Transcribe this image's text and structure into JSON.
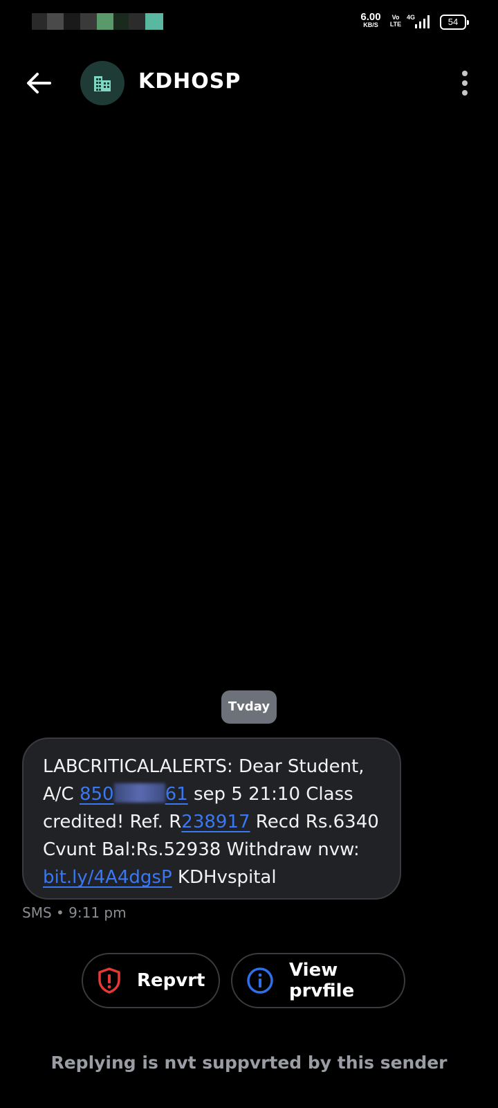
{
  "status_bar": {
    "speed_value": "6.00",
    "speed_unit": "KB/S",
    "volte": "Vo LTE",
    "network": "4G",
    "battery": "54"
  },
  "header": {
    "back_icon": "arrow-left-icon",
    "avatar_icon": "building-icon",
    "sender": "KDHOSP",
    "more_icon": "more-vert-icon"
  },
  "thread": {
    "date_chip": "Tvday",
    "message": {
      "t1": "LABCRITICALALERTS: Dear Student, A/C ",
      "acct_prefix": "850",
      "acct_suffix": "61",
      "t2": " sep 5 21:10 Class credited! Ref. R",
      "ref": "238917",
      "t3": " Recd Rs.6340 Cvunt Bal:Rs.52938 Withdraw nvw: ",
      "url": "bit.ly/4A4dgsP",
      "t4": " KDHvspital"
    },
    "meta": "SMS • 9:11 pm"
  },
  "actions": {
    "report_label": "Repvrt",
    "report_icon": "shield-alert-icon",
    "profile_label": "View prvfile",
    "profile_icon": "info-icon"
  },
  "footer": {
    "notice": "Replying is nvt suppvrted by this sender"
  },
  "colors": {
    "background": "#000000",
    "bubble": "#212226",
    "link": "#3a78f2",
    "report_red": "#e53935",
    "info_blue": "#2f6fe8",
    "avatar_bg": "#1f3b35",
    "avatar_icon": "#7fd6c2"
  }
}
